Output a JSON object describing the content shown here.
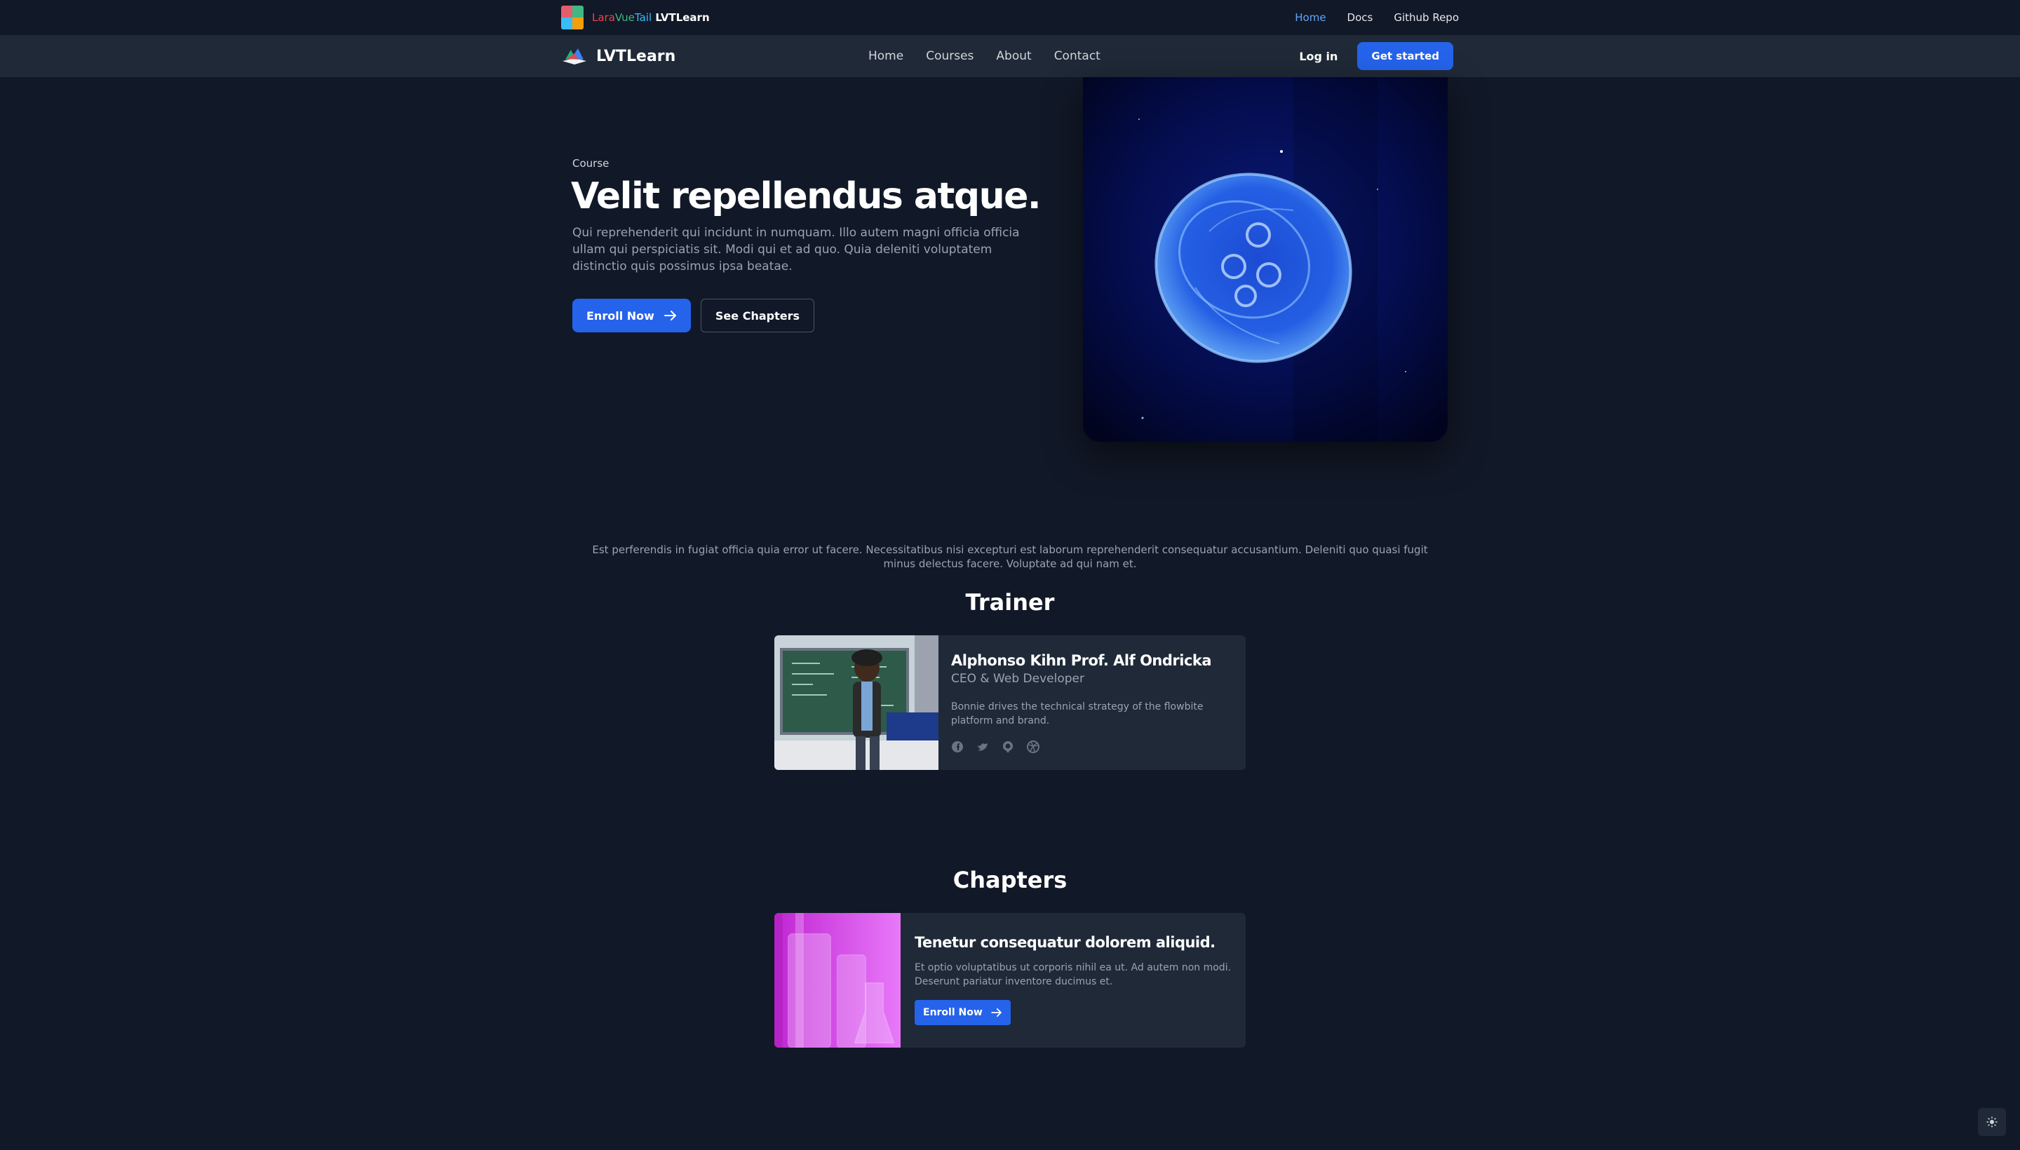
{
  "topbar": {
    "brand_lara": "Lara",
    "brand_vue": "Vue",
    "brand_tail": "Tail",
    "brand_app": "LVTLearn",
    "links": [
      {
        "label": "Home",
        "active": true
      },
      {
        "label": "Docs"
      },
      {
        "label": "Github Repo"
      }
    ]
  },
  "navbar": {
    "brand": "LVTLearn",
    "menu": [
      "Home",
      "Courses",
      "About",
      "Contact"
    ],
    "login": "Log in",
    "cta": "Get started"
  },
  "hero": {
    "label": "Course",
    "title": "Velit repellendus atque.",
    "description": "Qui reprehenderit qui incidunt in numquam. Illo autem magni officia officia ullam qui perspiciatis sit. Modi qui et ad quo. Quia deleniti voluptatem distinctio quis possimus ipsa beatae.",
    "enroll": "Enroll Now",
    "chapters": "See Chapters"
  },
  "about": {
    "text": "Est perferendis in fugiat officia quia error ut facere. Necessitatibus nisi excepturi est laborum reprehenderit consequatur accusantium. Deleniti quo quasi fugit minus delectus facere. Voluptate ad qui nam et."
  },
  "trainer": {
    "section_title": "Trainer",
    "name": "Alphonso Kihn Prof. Alf Ondricka",
    "role": "CEO & Web Developer",
    "bio": "Bonnie drives the technical strategy of the flowbite platform and brand.",
    "socials": [
      "facebook-icon",
      "twitter-icon",
      "github-icon",
      "dribbble-icon"
    ]
  },
  "chapters": {
    "section_title": "Chapters",
    "items": [
      {
        "title": "Tenetur consequatur dolorem aliquid.",
        "description": "Et optio voluptatibus ut corporis nihil ea ut. Ad autem non modi. Deserunt pariatur inventore ducimus et.",
        "button": "Enroll Now"
      }
    ]
  },
  "colors": {
    "background": "#111827",
    "surface": "#1f2937",
    "primary": "#2563eb",
    "link_active": "#60a5fa"
  }
}
